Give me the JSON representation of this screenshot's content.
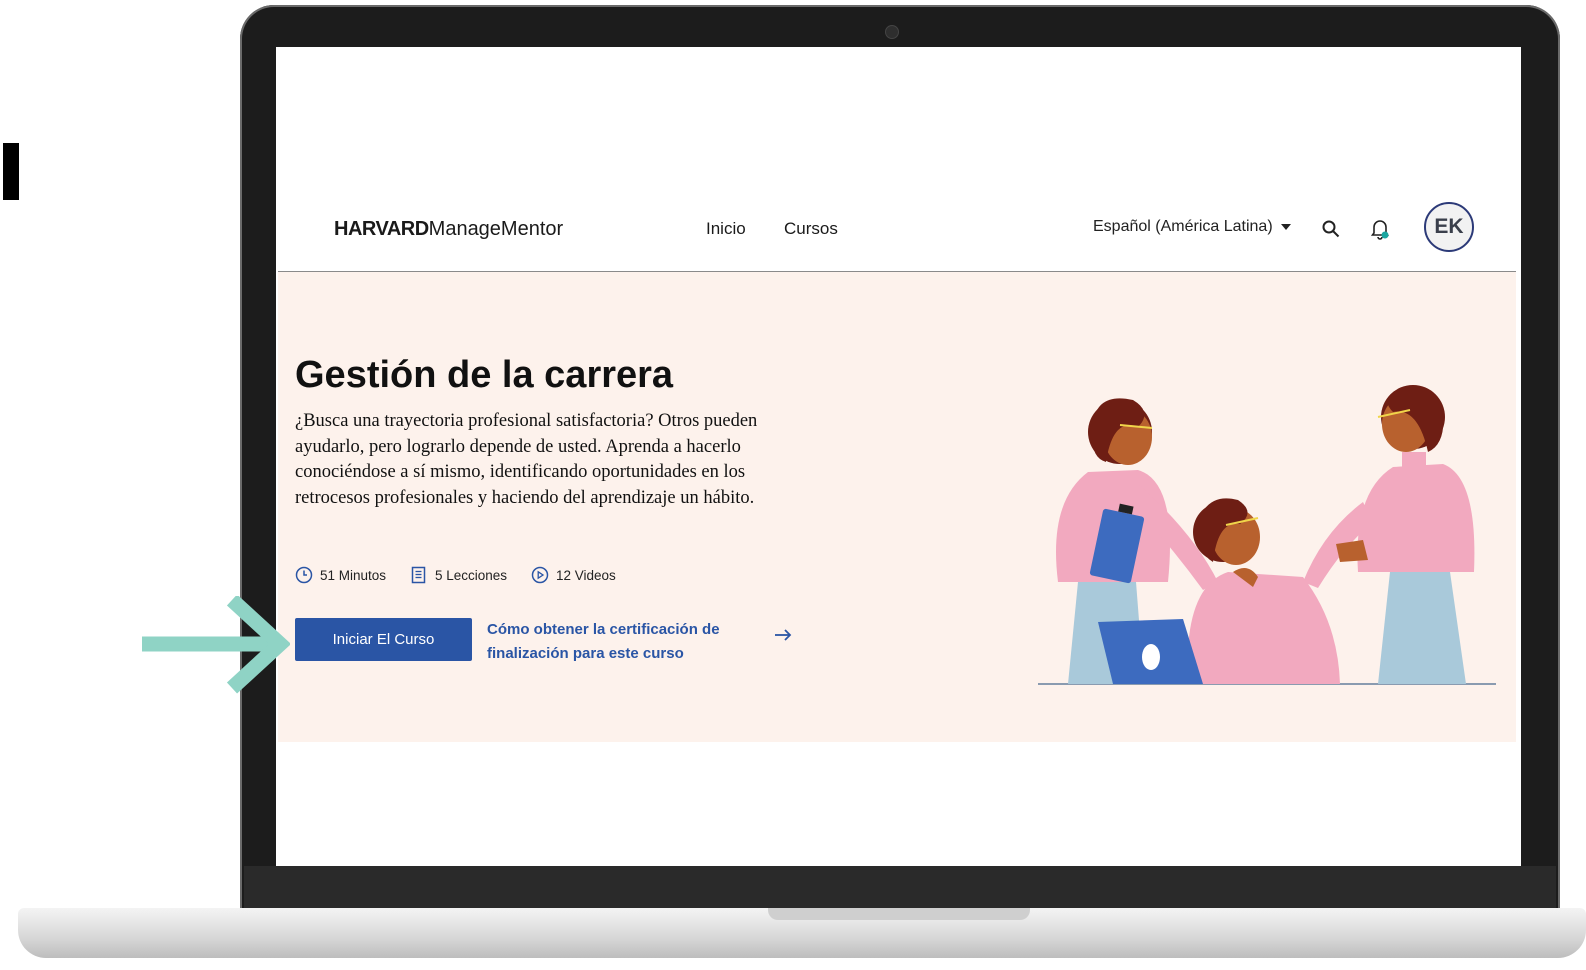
{
  "header": {
    "logo": {
      "brand": "HARVARD",
      "product": "ManageMentor"
    },
    "nav": [
      {
        "label": "Inicio"
      },
      {
        "label": "Cursos"
      }
    ],
    "language": "Español (América Latina)",
    "avatar_initials": "EK"
  },
  "hero": {
    "title": "Gestión de la carrera",
    "description": "¿Busca una trayectoria profesional satisfactoria? Otros pueden ayudarlo, pero lograrlo depende de usted. Aprenda a hacerlo conociéndose a sí mismo, identificando oportunidades en los retrocesos profesionales y haciendo del aprendizaje un hábito.",
    "meta": [
      {
        "icon": "clock-icon",
        "label": "51 Minutos"
      },
      {
        "icon": "book-icon",
        "label": "5 Lecciones"
      },
      {
        "icon": "play-circle-icon",
        "label": "12 Videos"
      }
    ],
    "start_button": "Iniciar El Curso",
    "cert_link": "Cómo obtener la certificación de finalización para este curso"
  },
  "colors": {
    "accent": "#2a55a5",
    "hero_bg": "#fdf2ec",
    "highlight_arrow": "#8fd3c5",
    "notification_dot": "#1aa6a0"
  }
}
